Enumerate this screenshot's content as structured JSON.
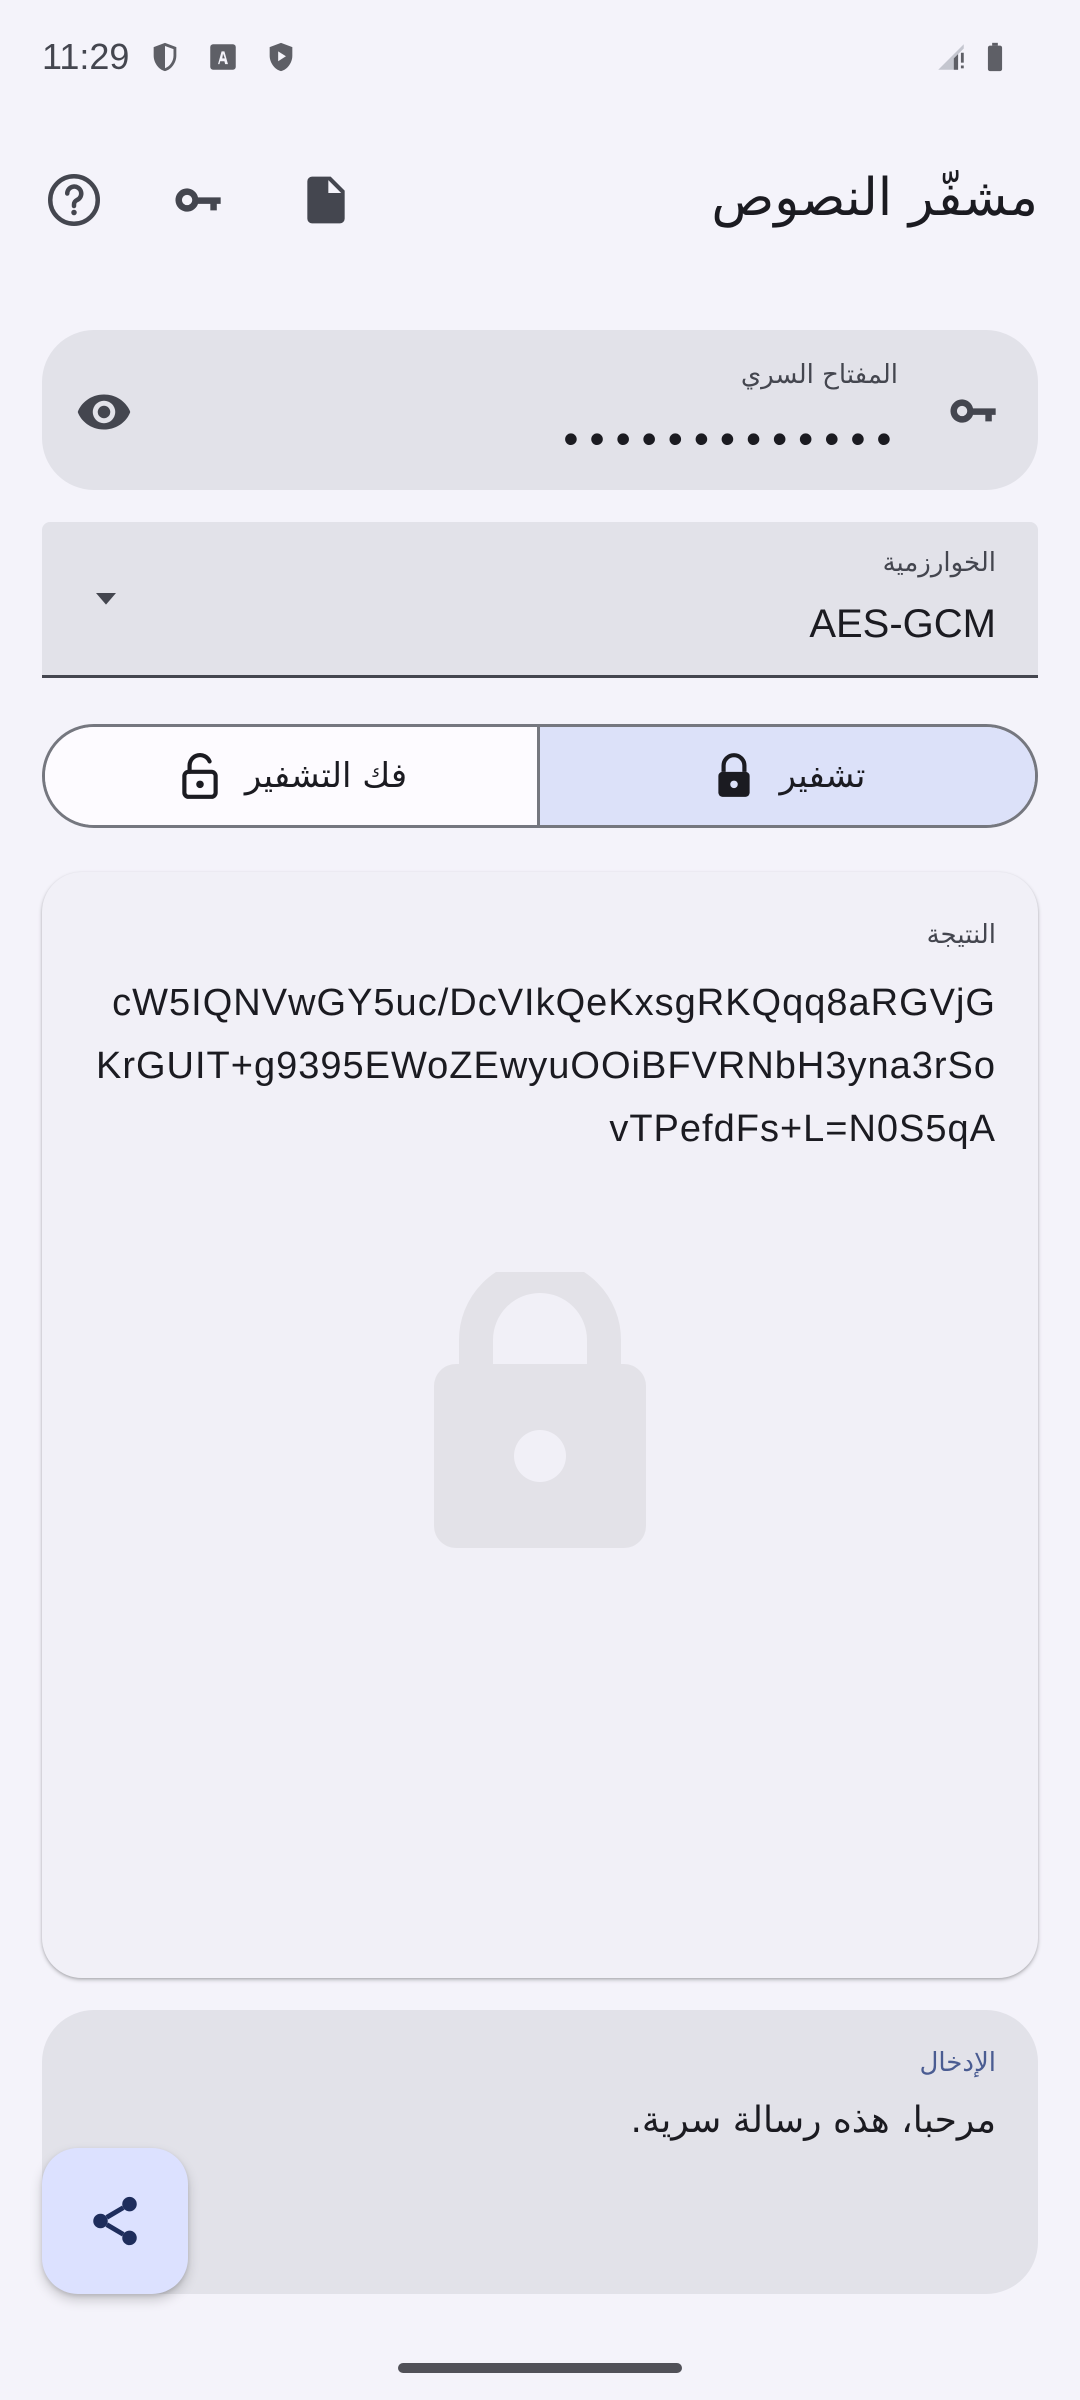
{
  "status_bar": {
    "time": "11:29"
  },
  "app_bar": {
    "title": "مشفّر النصوص",
    "actions": [
      "help-icon",
      "key-icon",
      "file-icon"
    ]
  },
  "key_field": {
    "label": "المفتاح السري",
    "value": "•••••••••••••"
  },
  "algorithm": {
    "label": "الخوارزمية",
    "value": "AES-GCM"
  },
  "mode": {
    "encrypt_label": "تشفير",
    "decrypt_label": "فك التشفير",
    "selected": "encrypt"
  },
  "result": {
    "label": "النتيجة",
    "text": "cW5IQNVwGY5uc/DcVIkQeKxsgRKQqq8aRGVjGKrGUIT+g9395EWoZEwyuOOiBFVRNbH3yna3rSovTPefdFs+L=N0S5qA"
  },
  "input": {
    "label": "الإدخال",
    "text": "مرحبا، هذه رسالة سرية."
  },
  "colors": {
    "background": "#f4f3fa",
    "field": "#e2e2e9",
    "selected_segment": "#dce1f9",
    "fab": "#dce1ff",
    "accent": "#4a5c92"
  }
}
